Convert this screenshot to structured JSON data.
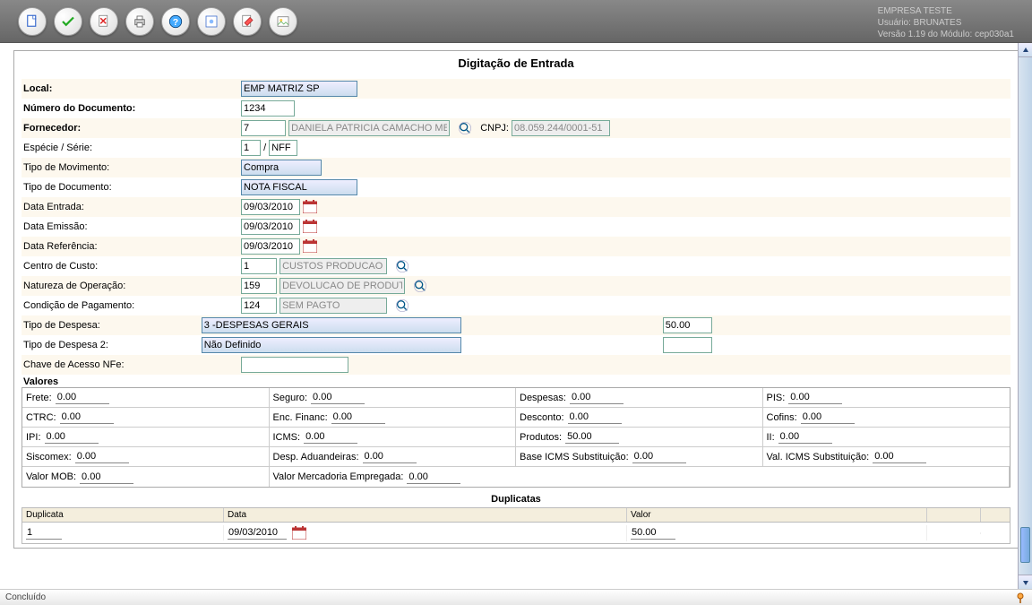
{
  "header": {
    "company": "EMPRESA TESTE",
    "user_label": "Usuário: BRUNATES",
    "version": "Versão 1.19 do Módulo: cep030a1"
  },
  "page_title": "Digitação de Entrada",
  "labels": {
    "local": "Local:",
    "numero_doc": "Número do Documento:",
    "fornecedor": "Fornecedor:",
    "cnpj": "CNPJ:",
    "especie_serie": "Espécie / Série:",
    "tipo_movimento": "Tipo de Movimento:",
    "tipo_documento": "Tipo de Documento:",
    "data_entrada": "Data Entrada:",
    "data_emissao": "Data Emissão:",
    "data_referencia": "Data Referência:",
    "centro_custo": "Centro de Custo:",
    "natureza_op": "Natureza de Operação:",
    "condicao_pag": "Condição de Pagamento:",
    "tipo_despesa": "Tipo de Despesa:",
    "tipo_despesa2": "Tipo de Despesa 2:",
    "chave_nfe": "Chave de Acesso NFe:",
    "valores": "Valores",
    "duplicatas": "Duplicatas"
  },
  "form": {
    "local": "EMP MATRIZ SP",
    "numero_doc": "1234",
    "fornecedor_cod": "7",
    "fornecedor_nome": "DANIELA PATRICIA CAMACHO ME",
    "cnpj": "08.059.244/0001-51",
    "especie": "1",
    "serie": "NFF",
    "tipo_movimento": "Compra",
    "tipo_documento": "NOTA FISCAL",
    "data_entrada": "09/03/2010",
    "data_emissao": "09/03/2010",
    "data_referencia": "09/03/2010",
    "centro_custo_cod": "1",
    "centro_custo_desc": "CUSTOS PRODUCAO",
    "natureza_cod": "159",
    "natureza_desc": "DEVOLUCAO DE PRODUTO",
    "condicao_cod": "124",
    "condicao_desc": "SEM PAGTO",
    "tipo_despesa": "3 -DESPESAS GERAIS",
    "tipo_despesa_valor": "50.00",
    "tipo_despesa2": "Não Definido",
    "tipo_despesa2_valor": "",
    "chave_nfe": ""
  },
  "valores": {
    "frete": {
      "label": "Frete:",
      "value": "0.00"
    },
    "seguro": {
      "label": "Seguro:",
      "value": "0.00"
    },
    "despesas": {
      "label": "Despesas:",
      "value": "0.00"
    },
    "pis": {
      "label": "PIS:",
      "value": "0.00"
    },
    "ctrc": {
      "label": "CTRC:",
      "value": "0.00"
    },
    "enc_financ": {
      "label": "Enc. Financ:",
      "value": "0.00"
    },
    "desconto": {
      "label": "Desconto:",
      "value": "0.00"
    },
    "cofins": {
      "label": "Cofins:",
      "value": "0.00"
    },
    "ipi": {
      "label": "IPI:",
      "value": "0.00"
    },
    "icms": {
      "label": "ICMS:",
      "value": "0.00"
    },
    "produtos": {
      "label": "Produtos:",
      "value": "50.00"
    },
    "ii": {
      "label": "II:",
      "value": "0.00"
    },
    "siscomex": {
      "label": "Siscomex:",
      "value": "0.00"
    },
    "desp_aduan": {
      "label": "Desp. Aduandeiras:",
      "value": "0.00"
    },
    "base_icms_sub": {
      "label": "Base ICMS Substituição:",
      "value": "0.00"
    },
    "val_icms_sub": {
      "label": "Val. ICMS Substituição:",
      "value": "0.00"
    },
    "valor_mob": {
      "label": "Valor MOB:",
      "value": "0.00"
    },
    "valor_merc_emp": {
      "label": "Valor Mercadoria Empregada:",
      "value": "0.00"
    }
  },
  "duplicatas": {
    "headers": {
      "duplicata": "Duplicata",
      "data": "Data",
      "valor": "Valor"
    },
    "rows": [
      {
        "duplicata": "1",
        "data": "09/03/2010",
        "valor": "50.00"
      }
    ]
  },
  "status": "Concluído"
}
